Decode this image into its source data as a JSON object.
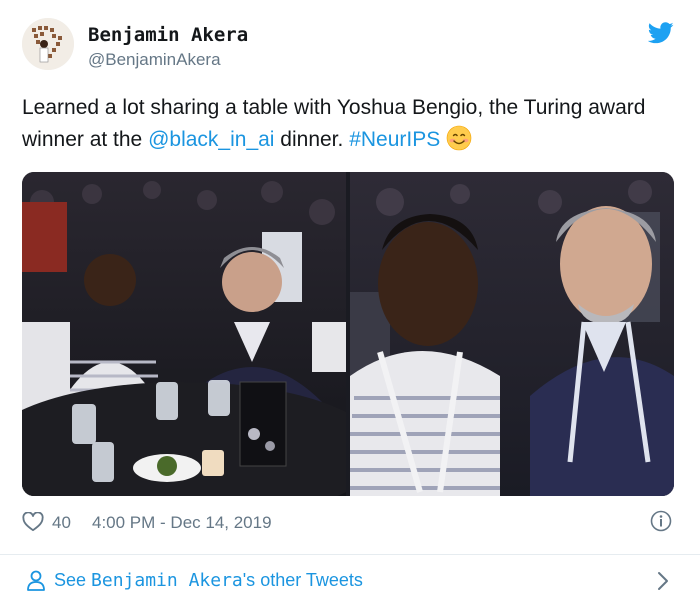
{
  "author": {
    "name": "Benjamin Akera",
    "handle": "@BenjaminAkera"
  },
  "tweet": {
    "text_before": "Learned a lot sharing a table with Yoshua Bengio, the Turing award winner at the ",
    "mention": "@black_in_ai",
    "text_middle": " dinner. ",
    "hashtag": "#NeurIPS",
    "emoji": "smiling-face-emoji"
  },
  "media": {
    "photos": [
      "left-dinner-photo",
      "right-selfie-photo"
    ]
  },
  "meta": {
    "likes": "40",
    "timestamp": "4:00 PM - Dec 14, 2019"
  },
  "footer": {
    "see_prefix": "See ",
    "see_name": "Benjamin Akera",
    "see_suffix": "'s other Tweets"
  },
  "colors": {
    "link": "#1b95e0",
    "secondary": "#657786",
    "text": "#14171a",
    "twitter_blue": "#1da1f2"
  }
}
